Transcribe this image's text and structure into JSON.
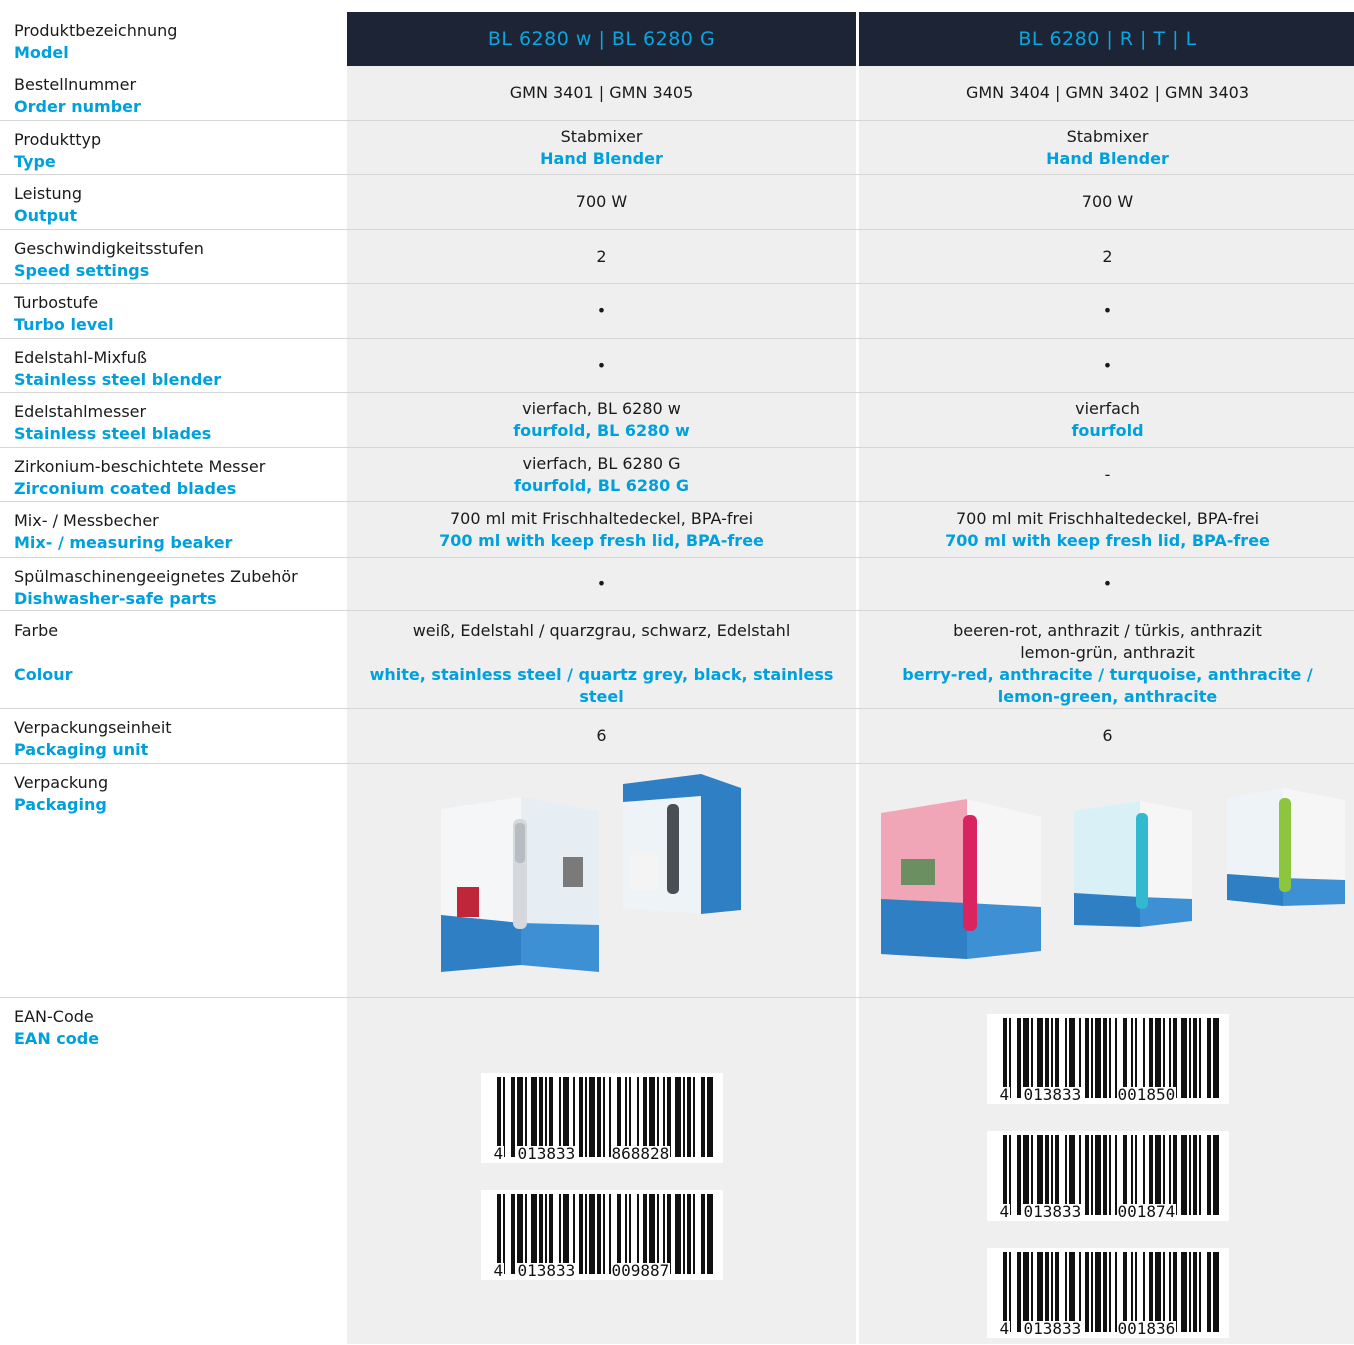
{
  "colors": {
    "accent": "#00a0dc",
    "header_bg": "#1c2435",
    "cell_bg": "#efefef"
  },
  "header": {
    "label_de": "Produktbezeichnung",
    "label_en": "Model",
    "model1": "BL 6280 w | BL 6280 G",
    "model2": "BL 6280 | R | T | L"
  },
  "rows": {
    "order": {
      "de": "Bestellnummer",
      "en": "Order number",
      "v1": "GMN 3401 | GMN 3405",
      "v2": "GMN 3404 | GMN 3402 | GMN 3403"
    },
    "type": {
      "de": "Produkttyp",
      "en": "Type",
      "v1_de": "Stabmixer",
      "v1_en": "Hand Blender",
      "v2_de": "Stabmixer",
      "v2_en": "Hand Blender"
    },
    "output": {
      "de": "Leistung",
      "en": "Output",
      "v1": "700 W",
      "v2": "700 W"
    },
    "speed": {
      "de": "Geschwindigkeitsstufen",
      "en": "Speed settings",
      "v1": "2",
      "v2": "2"
    },
    "turbo": {
      "de": "Turbostufe",
      "en": "Turbo level",
      "v1": "•",
      "v2": "•"
    },
    "blender": {
      "de": "Edelstahl-Mixfuß",
      "en": "Stainless steel blender",
      "v1": "•",
      "v2": "•"
    },
    "blades": {
      "de": "Edelstahlmesser",
      "en": "Stainless steel blades",
      "v1_de": "vierfach, BL 6280 w",
      "v1_en": "fourfold, BL 6280 w",
      "v2_de": "vierfach",
      "v2_en": "fourfold"
    },
    "zirconium": {
      "de": "Zirkonium-beschichtete Messer",
      "en": "Zirconium coated blades",
      "v1_de": "vierfach, BL 6280 G",
      "v1_en": "fourfold, BL 6280 G",
      "v2": "-"
    },
    "beaker": {
      "de": "Mix- / Messbecher",
      "en": "Mix- / measuring beaker",
      "v1_de": "700 ml mit Frischhaltedeckel, BPA-frei",
      "v1_en": "700 ml with keep fresh lid, BPA-free",
      "v2_de": "700 ml mit Frischhaltedeckel, BPA-frei",
      "v2_en": "700 ml with keep fresh lid, BPA-free"
    },
    "dishwasher": {
      "de": "Spülmaschinengeeignetes Zubehör",
      "en": "Dishwasher-safe parts",
      "v1": "•",
      "v2": "•"
    },
    "colour": {
      "de": "Farbe",
      "en": "Colour",
      "v1_de": "weiß, Edelstahl / quarzgrau, schwarz, Edelstahl",
      "v1_en": "white, stainless steel / quartz grey, black, stainless steel",
      "v2_de_1": "beeren-rot, anthrazit / türkis, anthrazit",
      "v2_de_2": "lemon-grün, anthrazit",
      "v2_en_1": "berry-red, anthracite / turquoise, anthracite /",
      "v2_en_2": "lemon-green, anthracite"
    },
    "pu": {
      "de": "Verpackungseinheit",
      "en": "Packaging unit",
      "v1": "6",
      "v2": "6"
    },
    "packaging": {
      "de": "Verpackung",
      "en": "Packaging"
    },
    "ean": {
      "de": "EAN-Code",
      "en": "EAN code",
      "col1": [
        {
          "first": "4",
          "left": "013833",
          "right": "868828"
        },
        {
          "first": "4",
          "left": "013833",
          "right": "009887"
        }
      ],
      "col2": [
        {
          "first": "4",
          "left": "013833",
          "right": "001850"
        },
        {
          "first": "4",
          "left": "013833",
          "right": "001874"
        },
        {
          "first": "4",
          "left": "013833",
          "right": "001836"
        }
      ]
    }
  }
}
